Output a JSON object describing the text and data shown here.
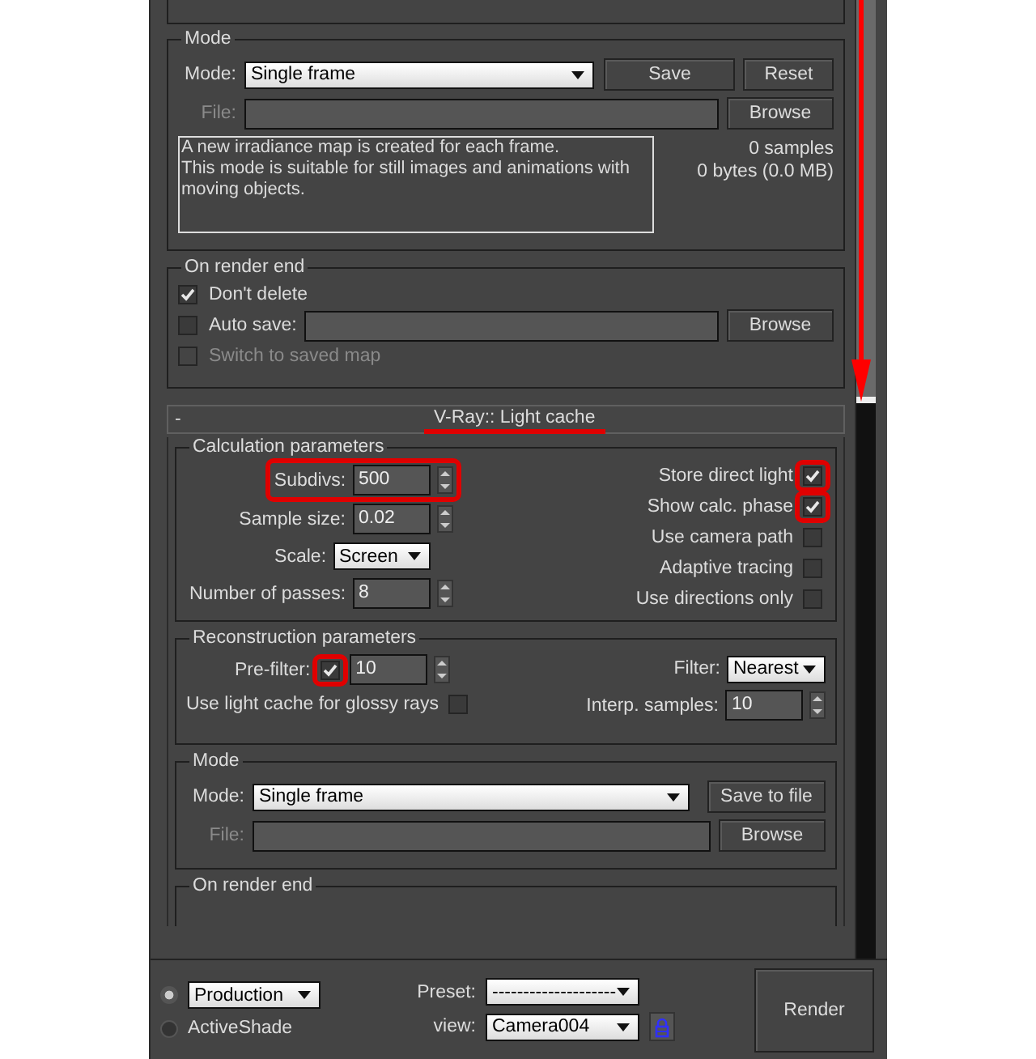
{
  "irradiance_mode": {
    "title": "Mode",
    "mode_label": "Mode:",
    "mode": "Single frame",
    "save": "Save",
    "reset": "Reset",
    "file": {
      "label": "File:",
      "browse": "Browse",
      "disabled": true
    },
    "description": "A new irradiance map is created for each frame.\nThis mode is suitable for still images and animations with moving objects.",
    "samples": "0 samples",
    "bytes": "0 bytes (0.0 MB)"
  },
  "on_render_end": {
    "title": "On render end",
    "options": [
      {
        "kind": "checkbox",
        "label": "Don't delete",
        "checked": true,
        "disabled": false
      },
      {
        "kind": "file",
        "label": "Auto save:",
        "checked": false,
        "disabled": false,
        "browse": "Browse"
      },
      {
        "kind": "checkbox",
        "label": "Switch to saved map",
        "checked": false,
        "disabled": true
      }
    ]
  },
  "rollout": {
    "collapse": "-",
    "title": "V-Ray:: Light cache",
    "underlined": true
  },
  "calculation": {
    "title": "Calculation parameters",
    "fields": [
      {
        "kind": "spinner",
        "label": "Subdivs:",
        "value": "500",
        "highlighted": true
      },
      {
        "kind": "spinner",
        "label": "Sample size:",
        "value": "0.02",
        "highlighted": false
      },
      {
        "kind": "dropdown",
        "label": "Scale:",
        "value": "Screen",
        "highlighted": false
      },
      {
        "kind": "spinner",
        "label": "Number of passes:",
        "value": "8",
        "highlighted": false
      }
    ],
    "options": [
      {
        "label": "Store direct light",
        "checked": true,
        "highlighted": true
      },
      {
        "label": "Show calc. phase",
        "checked": true,
        "highlighted": true
      },
      {
        "label": "Use camera path",
        "checked": false,
        "highlighted": false
      },
      {
        "label": "Adaptive tracing",
        "checked": false,
        "highlighted": false
      },
      {
        "label": "Use directions only",
        "checked": false,
        "highlighted": false
      }
    ]
  },
  "reconstruction": {
    "title": "Reconstruction parameters",
    "prefilter": {
      "label": "Pre-filter:",
      "checked": true,
      "highlighted": true,
      "value": "10"
    },
    "glossy": {
      "label": "Use light cache for glossy rays",
      "checked": false
    },
    "filter": {
      "label": "Filter:",
      "value": "Nearest"
    },
    "interp": {
      "label": "Interp. samples:",
      "value": "10"
    }
  },
  "light_cache_mode": {
    "title": "Mode",
    "mode_label": "Mode:",
    "mode": "Single frame",
    "save": "Save to file",
    "file": {
      "label": "File:",
      "browse": "Browse",
      "disabled": true
    }
  },
  "on_render_end_2": {
    "title": "On render end"
  },
  "footer": {
    "targets": [
      {
        "kind": "dropdown",
        "label": "Production",
        "selected": true
      },
      {
        "kind": "plain",
        "label": "ActiveShade",
        "selected": false
      }
    ],
    "preset_label": "Preset:",
    "preset": "--------------------",
    "view_label": "view:",
    "view": "Camera004",
    "render": "Render"
  }
}
